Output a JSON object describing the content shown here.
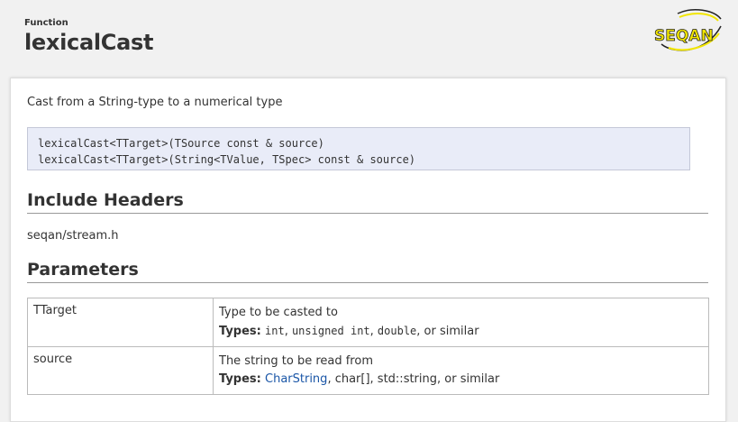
{
  "header": {
    "kind": "Function",
    "title": "lexicalCast",
    "logo_text": "SEQAN"
  },
  "summary": "Cast from a String-type to a numerical type",
  "signature": [
    "lexicalCast<TTarget>(TSource const & source)",
    "lexicalCast<TTarget>(String<TValue, TSpec> const & source)"
  ],
  "include": {
    "heading": "Include Headers",
    "file": "seqan/stream.h"
  },
  "parameters": {
    "heading": "Parameters",
    "types_label": "Types:",
    "rows": [
      {
        "name": "TTarget",
        "description": "Type to be casted to",
        "types": [
          "int",
          "unsigned int",
          "double"
        ],
        "types_suffix": ", or similar"
      },
      {
        "name": "source",
        "description": "The string to be read from",
        "types_link": "CharString",
        "types_rest": ", char[], std::string, or similar"
      }
    ]
  },
  "colors": {
    "signature_bg": "#e9ecf8",
    "link": "#1a56a7",
    "logo_yellow": "#f2e600"
  }
}
